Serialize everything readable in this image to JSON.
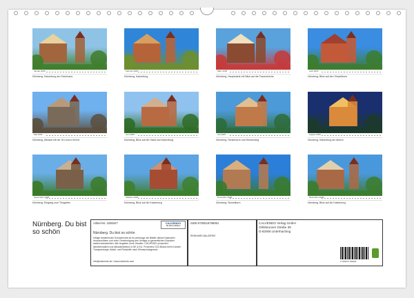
{
  "thumbs": [
    {
      "cal": "Januar 2025",
      "caption": "Nürnberg, Kaiserburg am Dürerhaus"
    },
    {
      "cal": "Februar 2025",
      "caption": "Nürnberg, Kaiserburg"
    },
    {
      "cal": "März 2025",
      "caption": "Nürnberg, Hauptmarkt mit Blick auf die Frauenkirche"
    },
    {
      "cal": "April 2025",
      "caption": "Nürnberg, Blick auf den Sinwellturm"
    },
    {
      "cal": "Mai 2025",
      "caption": "Nürnberg, Altstadt mit der St.Lorenz Kirche"
    },
    {
      "cal": "Juni 2025",
      "caption": "Nürnberg, Blick auf die Stadt und Kaiserburg"
    },
    {
      "cal": "Juli 2025",
      "caption": "Nürnberg, Henkerturm und Henkersteg"
    },
    {
      "cal": "August 2025",
      "caption": "Nürnberg, Kaiserburg am Abend"
    },
    {
      "cal": "September 2025",
      "caption": "Nürnberg, Eingang zum Tiergarten"
    },
    {
      "cal": "Oktober 2025",
      "caption": "Nürnberg, Blick auf die Kaiserburg"
    },
    {
      "cal": "November 2025",
      "caption": "Nürnberg, Sinwellturm"
    },
    {
      "cal": "Dezember 2025",
      "caption": "Nürnberg, Blick auf die Kaiserburg"
    }
  ],
  "footer": {
    "title": "Nürnberg. Du bist so schön",
    "article": "Artikel-Nr. 2265347",
    "logo": "CALVENDO",
    "logo_sub": "Die Welt in Bildern",
    "subtitle": "Nürnberg. Du bist so schön",
    "isbn": "ISBN 9783516769081",
    "author": "REINHARD BALZEREK",
    "publisher": "CALVENDO Verlag GmbH",
    "street": "Ohlsbrunner Straße 39",
    "city": "D-82006 Unterhaching",
    "legal": "Infolge bestehender Schutzrechte ist es untersagt, die Blätter dieses Kalenders herauszulösen und ohne Genehmigung des Verlags zu gewerblichen Zwecken weiterzuverarbeiten. Alle Angaben ohne Gewähr. CALVENDO produziert klimafreundlich und klimaabhebend in DE & EU. Proofview CO2-Bilanz beim Kunden Transportwege, Abfall- und Rohstoffe nach Klimaschutzgesetz.",
    "contact": "Info@calvendo.de / www.calvendo.com",
    "barcode_num": "9 783516 769081"
  }
}
